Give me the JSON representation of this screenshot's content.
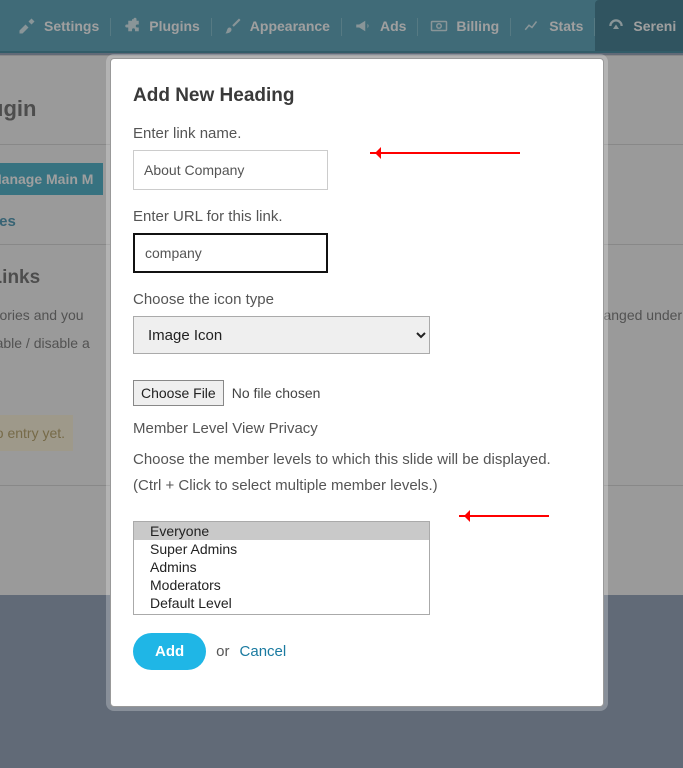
{
  "toolbar": {
    "items": [
      {
        "label": "Settings"
      },
      {
        "label": "Plugins"
      },
      {
        "label": "Appearance"
      },
      {
        "label": "Ads"
      },
      {
        "label": "Billing"
      },
      {
        "label": "Stats"
      },
      {
        "label": "Sereni"
      }
    ]
  },
  "background": {
    "page_title_partial": "ugin",
    "tab_label_partial": "Manage Main M",
    "link_partial": "ories",
    "section_heading_partial": "l Links",
    "desc_line1_partial": "tegories and you",
    "desc_line1_tail": "anged under v",
    "desc_line2_partial": "enable / disable a",
    "no_entry_partial": "no entry yet."
  },
  "modal": {
    "title": "Add New Heading",
    "link_name_label": "Enter link name.",
    "link_name_value": "About Company",
    "url_label": "Enter URL for this link.",
    "url_value": "company",
    "icon_type_label": "Choose the icon type",
    "icon_type_value": "Image Icon",
    "file_button": "Choose File",
    "file_status": "No file chosen",
    "privacy_title": "Member Level View Privacy",
    "privacy_desc": "Choose the member levels to which this slide will be displayed. (Ctrl + Click to select multiple member levels.)",
    "levels": [
      "Everyone",
      "Super Admins",
      "Admins",
      "Moderators",
      "Default Level"
    ],
    "add_label": "Add",
    "or_label": "or",
    "cancel_label": "Cancel"
  }
}
